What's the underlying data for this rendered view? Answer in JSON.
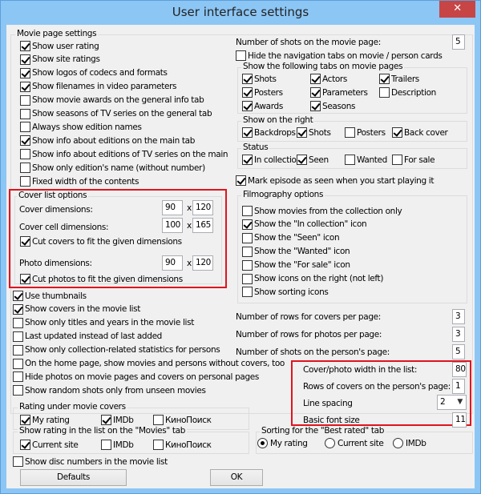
{
  "window": {
    "title": "User interface settings",
    "close_label": "✕"
  },
  "movie_page_settings": {
    "label": "Movie page settings",
    "items": [
      {
        "label": "Show user rating",
        "checked": true
      },
      {
        "label": "Show site ratings",
        "checked": true
      },
      {
        "label": "Show logos of codecs and formats",
        "checked": true
      },
      {
        "label": "Show filenames in video parameters",
        "checked": true
      },
      {
        "label": "Show movie awards on the general info tab",
        "checked": false
      },
      {
        "label": "Show seasons of TV series on the general tab",
        "checked": false
      },
      {
        "label": "Always show edition names",
        "checked": false
      },
      {
        "label": "Show info about editions on the main tab",
        "checked": true
      },
      {
        "label": "Show info about editions of TV series on the main",
        "checked": false
      },
      {
        "label": "Show only edition's name (without number)",
        "checked": false
      },
      {
        "label": "Fixed width of the contents",
        "checked": false
      }
    ]
  },
  "cover_list_options": {
    "label": "Cover list options",
    "cover_dimensions": {
      "label": "Cover dimensions:",
      "width": "90",
      "height": "120"
    },
    "cover_cell_dimensions": {
      "label": "Cover cell dimensions:",
      "width": "100",
      "height": "165"
    },
    "cut_covers": {
      "label": "Cut covers to fit the given dimensions",
      "checked": true
    },
    "photo_dimensions": {
      "label": "Photo dimensions:",
      "width": "90",
      "height": "120"
    },
    "cut_photos": {
      "label": "Cut photos to fit the given dimensions",
      "checked": true
    },
    "x_sep": "x"
  },
  "left_checks": [
    {
      "label": "Use thumbnails",
      "checked": true
    },
    {
      "label": "Show covers in the movie list",
      "checked": true
    },
    {
      "label": "Show only titles and years in the movie list",
      "checked": false
    },
    {
      "label": "Last updated instead of last added",
      "checked": false
    },
    {
      "label": "Show only collection-related statistics for persons",
      "checked": false
    },
    {
      "label": "On the home page, show movies and persons without covers, too",
      "checked": false
    },
    {
      "label": "Hide photos on movie pages and covers on personal pages",
      "checked": false
    },
    {
      "label": "Show random shots only from unseen movies",
      "checked": false
    }
  ],
  "rating_under_covers": {
    "label": "Rating under movie covers",
    "items": [
      {
        "label": "My rating",
        "checked": true
      },
      {
        "label": "IMDb",
        "checked": true
      },
      {
        "label": "КиноПоиск",
        "checked": false
      }
    ]
  },
  "rating_in_list": {
    "label": "Show rating in the list on the \"Movies\" tab",
    "items": [
      {
        "label": "Current site",
        "checked": true
      },
      {
        "label": "IMDb",
        "checked": false
      },
      {
        "label": "КиноПоиск",
        "checked": false
      }
    ]
  },
  "show_disc_numbers": {
    "label": "Show disc numbers in the movie list",
    "checked": false
  },
  "buttons": {
    "defaults": "Defaults",
    "ok": "OK"
  },
  "right": {
    "shots_on_movie_page": {
      "label": "Number of shots on the movie page:",
      "value": "5"
    },
    "hide_nav_tabs": {
      "label": "Hide the navigation tabs on movie / person cards",
      "checked": false
    },
    "tabs_group": {
      "label": "Show the following tabs on movie pages",
      "items": [
        {
          "label": "Shots",
          "checked": true
        },
        {
          "label": "Actors",
          "checked": true
        },
        {
          "label": "Trailers",
          "checked": true
        },
        {
          "label": "Posters",
          "checked": true
        },
        {
          "label": "Parameters",
          "checked": true
        },
        {
          "label": "Description",
          "checked": false
        },
        {
          "label": "Awards",
          "checked": true
        },
        {
          "label": "Seasons",
          "checked": true
        }
      ]
    },
    "show_on_right": {
      "label": "Show on the right",
      "items": [
        {
          "label": "Backdrops",
          "checked": true
        },
        {
          "label": "Shots",
          "checked": true
        },
        {
          "label": "Posters",
          "checked": false
        },
        {
          "label": "Back cover",
          "checked": true
        }
      ]
    },
    "status": {
      "label": "Status",
      "items": [
        {
          "label": "In collection",
          "checked": true
        },
        {
          "label": "Seen",
          "checked": true
        },
        {
          "label": "Wanted",
          "checked": false
        },
        {
          "label": "For sale",
          "checked": false
        }
      ]
    },
    "mark_episode": {
      "label": "Mark episode as seen when you start playing it",
      "checked": true
    },
    "filmography": {
      "label": "Filmography options",
      "items": [
        {
          "label": "Show movies from the collection only",
          "checked": false
        },
        {
          "label": "Show the \"In collection\" icon",
          "checked": true
        },
        {
          "label": "Show the \"Seen\" icon",
          "checked": false
        },
        {
          "label": "Show the \"Wanted\" icon",
          "checked": false
        },
        {
          "label": "Show the \"For sale\" icon",
          "checked": false
        },
        {
          "label": "Show icons on the right (not left)",
          "checked": false
        },
        {
          "label": "Show sorting icons",
          "checked": false
        }
      ]
    },
    "rows_covers": {
      "label": "Number of rows for covers per page:",
      "value": "3"
    },
    "rows_photos": {
      "label": "Number of rows for photos per page:",
      "value": "3"
    },
    "shots_person": {
      "label": "Number of shots on the person's page:",
      "value": "5"
    },
    "cover_photo_width": {
      "label": "Cover/photo width in the list:",
      "value": "80"
    },
    "rows_covers_person": {
      "label": "Rows of covers on the person's page:",
      "value": "1"
    },
    "line_spacing": {
      "label": "Line spacing",
      "value": "2"
    },
    "basic_font_size": {
      "label": "Basic font size",
      "value": "11"
    },
    "best_rated": {
      "label": "Sorting for the \"Best rated\" tab",
      "options": [
        {
          "label": "My rating",
          "selected": true
        },
        {
          "label": "Current site",
          "selected": false
        },
        {
          "label": "IMDb",
          "selected": false
        }
      ]
    }
  }
}
